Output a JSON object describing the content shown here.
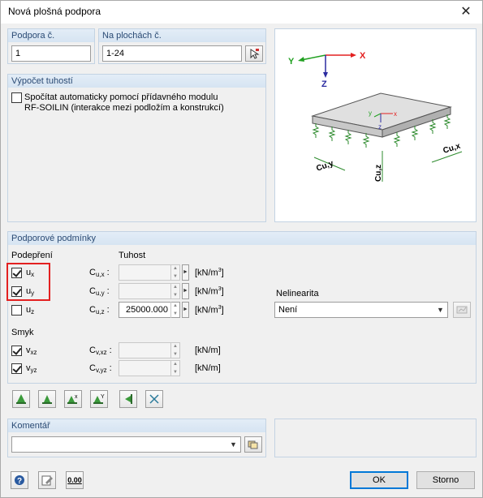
{
  "window": {
    "title": "Nová plošná podpora",
    "close_glyph": "✕"
  },
  "support_no": {
    "label": "Podpora č.",
    "value": "1"
  },
  "on_surfaces": {
    "label": "Na plochách č.",
    "value": "1-24"
  },
  "stiffness_calc": {
    "label": "Výpočet tuhostí",
    "checkbox_line1": "Spočítat automaticky pomocí přídavného modulu",
    "checkbox_line2": "RF-SOILIN (interakce mezi podložím a konstrukcí)",
    "checked": false
  },
  "preview": {
    "axis_x": "X",
    "axis_y": "Y",
    "axis_z": "Z",
    "local_x": "x",
    "local_y": "y",
    "local_z": "z",
    "c_ux": "Cu,x",
    "c_uy": "Cu,y",
    "c_uz": "Cu,z",
    "color_global_x": "#e32020",
    "color_global_y": "#20a020",
    "color_global_z": "#2a2aa0"
  },
  "conditions": {
    "label": "Podporové podmínky",
    "support_header": "Podepření",
    "stiffness_header": "Tuhost",
    "rows": [
      {
        "main": "u",
        "sub": "x",
        "checked": true,
        "coef": "C",
        "coef_sub": "u,x",
        "value": "",
        "unit": "[kN/m",
        "unit_sup": "3",
        "unit_end": "]"
      },
      {
        "main": "u",
        "sub": "y",
        "checked": true,
        "coef": "C",
        "coef_sub": "u,y",
        "value": "",
        "unit": "[kN/m",
        "unit_sup": "3",
        "unit_end": "]"
      },
      {
        "main": "u",
        "sub": "z",
        "checked": false,
        "coef": "C",
        "coef_sub": "u,z",
        "value": "25000.000",
        "unit": "[kN/m",
        "unit_sup": "3",
        "unit_end": "]"
      }
    ],
    "shear_header": "Smyk",
    "shear_rows": [
      {
        "main": "v",
        "sub": "xz",
        "checked": true,
        "coef": "C",
        "coef_sub": "v,xz",
        "value": "",
        "unit": "[kN/m]"
      },
      {
        "main": "v",
        "sub": "yz",
        "checked": true,
        "coef": "C",
        "coef_sub": "v,yz",
        "value": "",
        "unit": "[kN/m]"
      }
    ],
    "nonlinearity": {
      "label": "Nelinearita",
      "value": "Není"
    }
  },
  "comment": {
    "label": "Komentář",
    "value": ""
  },
  "footer": {
    "ok": "OK",
    "cancel": "Storno",
    "units_icon_text": "0.00"
  }
}
